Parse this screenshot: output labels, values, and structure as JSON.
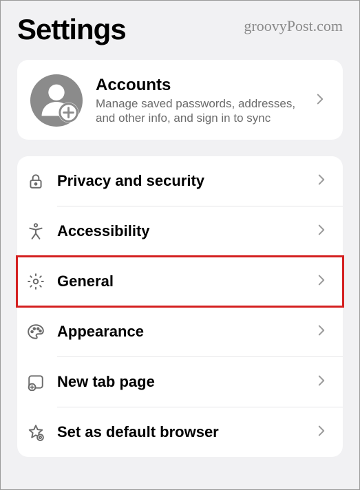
{
  "page_title": "Settings",
  "watermark": "groovyPost.com",
  "accounts": {
    "title": "Accounts",
    "subtitle": "Manage saved passwords, addresses, and other info, and sign in to sync"
  },
  "rows": [
    {
      "icon": "lock-icon",
      "label": "Privacy and security",
      "highlighted": false
    },
    {
      "icon": "accessibility-icon",
      "label": "Accessibility",
      "highlighted": false
    },
    {
      "icon": "gear-icon",
      "label": "General",
      "highlighted": true
    },
    {
      "icon": "palette-icon",
      "label": "Appearance",
      "highlighted": false
    },
    {
      "icon": "tab-plus-icon",
      "label": "New tab page",
      "highlighted": false
    },
    {
      "icon": "star-gear-icon",
      "label": "Set as default browser",
      "highlighted": false
    }
  ]
}
